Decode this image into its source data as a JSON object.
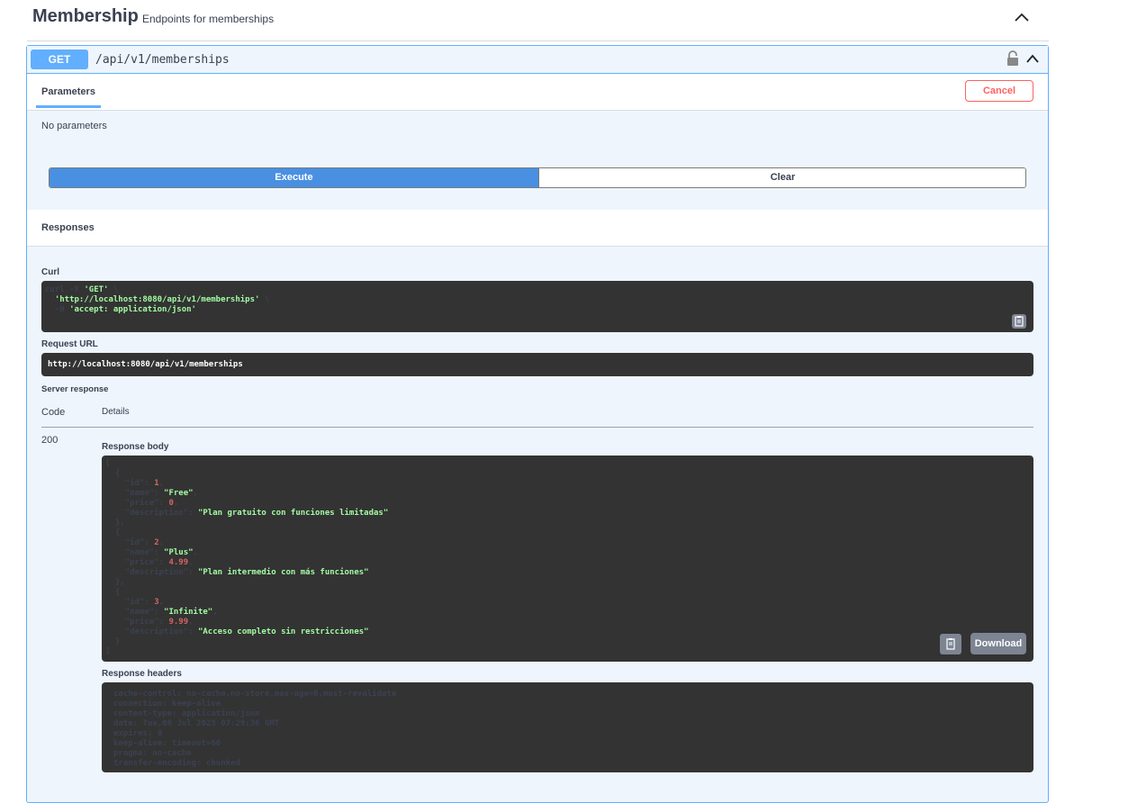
{
  "tag": {
    "title": "Membership",
    "description": "Endpoints for memberships"
  },
  "operation": {
    "method": "GET",
    "path": "/api/v1/memberships"
  },
  "parameters": {
    "tab_label": "Parameters",
    "cancel_label": "Cancel",
    "empty_text": "No parameters"
  },
  "actions": {
    "execute_label": "Execute",
    "clear_label": "Clear"
  },
  "responses": {
    "title": "Responses",
    "curl_label": "Curl",
    "curl_lines": [
      [
        "curl -X ",
        "'GET'",
        " \\"
      ],
      [
        "  ",
        "'http://localhost:8080/api/v1/memberships'",
        " \\"
      ],
      [
        "  -H ",
        "'accept: application/json'",
        ""
      ]
    ],
    "request_url_label": "Request URL",
    "request_url": "http://localhost:8080/api/v1/memberships",
    "server_response_label": "Server response",
    "code_header": "Code",
    "details_header": "Details",
    "code": "200",
    "response_body_label": "Response body",
    "response_body": [
      {
        "id": 1,
        "name": "Free",
        "price": "0",
        "description": "Plan gratuito con funciones limitadas"
      },
      {
        "id": 2,
        "name": "Plus",
        "price": "4.99",
        "description": "Plan intermedio con más funciones"
      },
      {
        "id": 3,
        "name": "Infinite",
        "price": "9.99",
        "description": "Acceso completo sin restricciones"
      }
    ],
    "download_label": "Download",
    "response_headers_label": "Response headers",
    "response_headers": [
      "cache-control: no-cache,no-store,max-age=0,must-revalidate",
      "connection: keep-alive",
      "content-type: application/json",
      "date: Tue,08 Jul 2025 07:29:36 GMT",
      "expires: 0",
      "keep-alive: timeout=60",
      "pragma: no-cache",
      "transfer-encoding: chunked"
    ]
  },
  "colors": {
    "get_accent": "#61affe",
    "execute": "#4990e2",
    "cancel": "#ff6060",
    "code_bg": "#333333",
    "json_string": "#a2fca2",
    "json_number": "#d36363"
  },
  "icons": [
    "chevron-up-icon",
    "lock-icon",
    "copy-icon"
  ]
}
